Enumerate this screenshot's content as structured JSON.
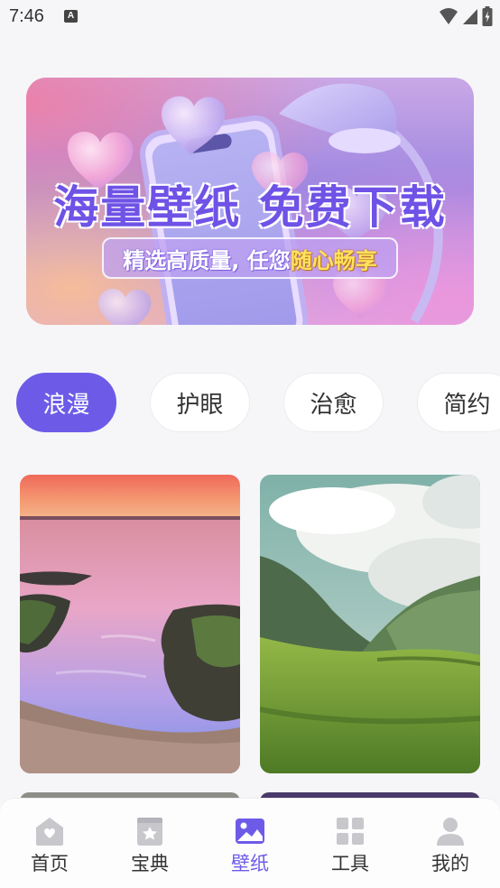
{
  "status_bar": {
    "time": "7:46",
    "notification_icon": "A"
  },
  "banner": {
    "title": "海量壁纸 免费下载",
    "subtitle_part1": "精选高质量, 任您",
    "subtitle_part2": "随心畅享"
  },
  "categories": [
    {
      "label": "浪漫",
      "active": true
    },
    {
      "label": "护眼",
      "active": false
    },
    {
      "label": "治愈",
      "active": false
    },
    {
      "label": "简约",
      "active": false
    }
  ],
  "wallpapers": [
    {
      "subject": "sunset-seashore"
    },
    {
      "subject": "green-mountain-valley"
    }
  ],
  "bottom_nav": [
    {
      "label": "首页",
      "icon": "home-icon",
      "active": false
    },
    {
      "label": "宝典",
      "icon": "book-star-icon",
      "active": false
    },
    {
      "label": "壁纸",
      "icon": "image-icon",
      "active": true
    },
    {
      "label": "工具",
      "icon": "grid-icon",
      "active": false
    },
    {
      "label": "我的",
      "icon": "person-icon",
      "active": false
    }
  ],
  "colors": {
    "accent": "#6d5be8",
    "inactive_icon": "#c7c7cc",
    "background": "#f6f6f8"
  }
}
